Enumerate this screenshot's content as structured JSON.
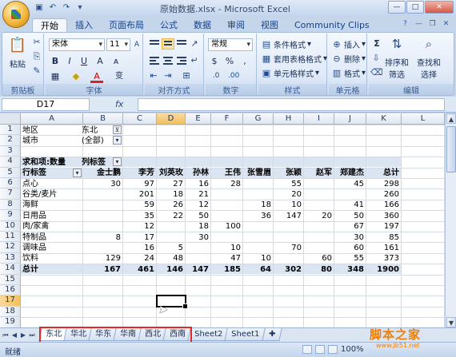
{
  "window": {
    "title": "原始数据.xlsx - Microsoft Excel",
    "controls": [
      "—",
      "□",
      "✕"
    ]
  },
  "quick_access": [
    "save-icon",
    "undo-icon",
    "redo-icon",
    "customize-icon"
  ],
  "tabs": [
    {
      "label": "开始",
      "active": true
    },
    {
      "label": "插入"
    },
    {
      "label": "页面布局"
    },
    {
      "label": "公式"
    },
    {
      "label": "数据"
    },
    {
      "label": "审阅"
    },
    {
      "label": "视图"
    },
    {
      "label": "Community Clips"
    }
  ],
  "ribbon": {
    "clipboard": {
      "label": "剪贴板",
      "paste": "粘贴"
    },
    "font": {
      "label": "字体",
      "name": "宋体",
      "size": "11",
      "bold": "B",
      "italic": "I",
      "underline": "U",
      "grow": "A",
      "font_color": "A",
      "wen": "变"
    },
    "alignment": {
      "label": "对齐方式"
    },
    "number": {
      "label": "数字",
      "format": "常规",
      "percent": "%",
      "comma": ",",
      "currency": "$"
    },
    "styles": {
      "label": "样式",
      "cond_fmt": "条件格式",
      "table_fmt": "套用表格格式",
      "cell_styles": "单元格样式"
    },
    "cells": {
      "label": "单元格",
      "insert": "插入",
      "delete": "删除",
      "format": "格式"
    },
    "editing": {
      "label": "编辑",
      "sort": "排序和",
      "sort2": "筛选",
      "find": "查找和",
      "find2": "选择",
      "sum": "Σ"
    }
  },
  "formula_bar": {
    "name_box": "D17",
    "fx": "fx",
    "value": ""
  },
  "columns": [
    "A",
    "B",
    "C",
    "D",
    "E",
    "F",
    "G",
    "H",
    "I",
    "J",
    "K",
    "L"
  ],
  "rows": [
    "1",
    "2",
    "3",
    "4",
    "5",
    "6",
    "7",
    "8",
    "9",
    "10",
    "11",
    "12",
    "13",
    "14",
    "15",
    "16",
    "17",
    "18",
    "19"
  ],
  "active_cell": "D17",
  "pivot": {
    "filter_labels": [
      "地区",
      "城市"
    ],
    "filter_values": [
      "东北",
      "(全部)"
    ],
    "value_label": "求和项:数量",
    "col_label": "列标签",
    "row_label": "行标签",
    "headers": [
      "金士鹏",
      "李芳",
      "刘英玫",
      "孙林",
      "王伟",
      "张雪眉",
      "张颖",
      "赵军",
      "郑建杰",
      "总计"
    ],
    "rows": [
      {
        "label": "点心",
        "vals": [
          "30",
          "97",
          "27",
          "16",
          "28",
          "",
          "55",
          "",
          "45",
          "298"
        ]
      },
      {
        "label": "谷类/麦片",
        "vals": [
          "",
          "201",
          "18",
          "21",
          "",
          "",
          "20",
          "",
          "",
          "260"
        ]
      },
      {
        "label": "海鲜",
        "vals": [
          "",
          "59",
          "26",
          "12",
          "",
          "18",
          "10",
          "",
          "41",
          "166"
        ]
      },
      {
        "label": "日用品",
        "vals": [
          "",
          "35",
          "22",
          "50",
          "",
          "36",
          "147",
          "20",
          "50",
          "360"
        ]
      },
      {
        "label": "肉/家禽",
        "vals": [
          "",
          "12",
          "",
          "18",
          "100",
          "",
          "",
          "",
          "67",
          "197"
        ]
      },
      {
        "label": "特制品",
        "vals": [
          "8",
          "17",
          "",
          "30",
          "",
          "",
          "",
          "",
          "30",
          "85"
        ]
      },
      {
        "label": "调味品",
        "vals": [
          "",
          "16",
          "5",
          "",
          "10",
          "",
          "70",
          "",
          "60",
          "161"
        ]
      },
      {
        "label": "饮料",
        "vals": [
          "129",
          "24",
          "48",
          "",
          "47",
          "10",
          "",
          "60",
          "55",
          "373"
        ]
      }
    ],
    "total_label": "总计",
    "totals": [
      "167",
      "461",
      "146",
      "147",
      "185",
      "64",
      "302",
      "80",
      "348",
      "1900"
    ]
  },
  "sheets": [
    "东北",
    "华北",
    "华东",
    "华南",
    "西北",
    "西南",
    "Sheet2",
    "Sheet1"
  ],
  "active_sheet": "东北",
  "status": {
    "mode": "就绪",
    "zoom": "100%"
  },
  "watermark": {
    "text": "脚本之家",
    "sub": "www.jb51.net"
  },
  "colors": {
    "accent": "#15428b",
    "pivot_band": "#dbe5f1",
    "highlight_box": "#e0292a"
  }
}
